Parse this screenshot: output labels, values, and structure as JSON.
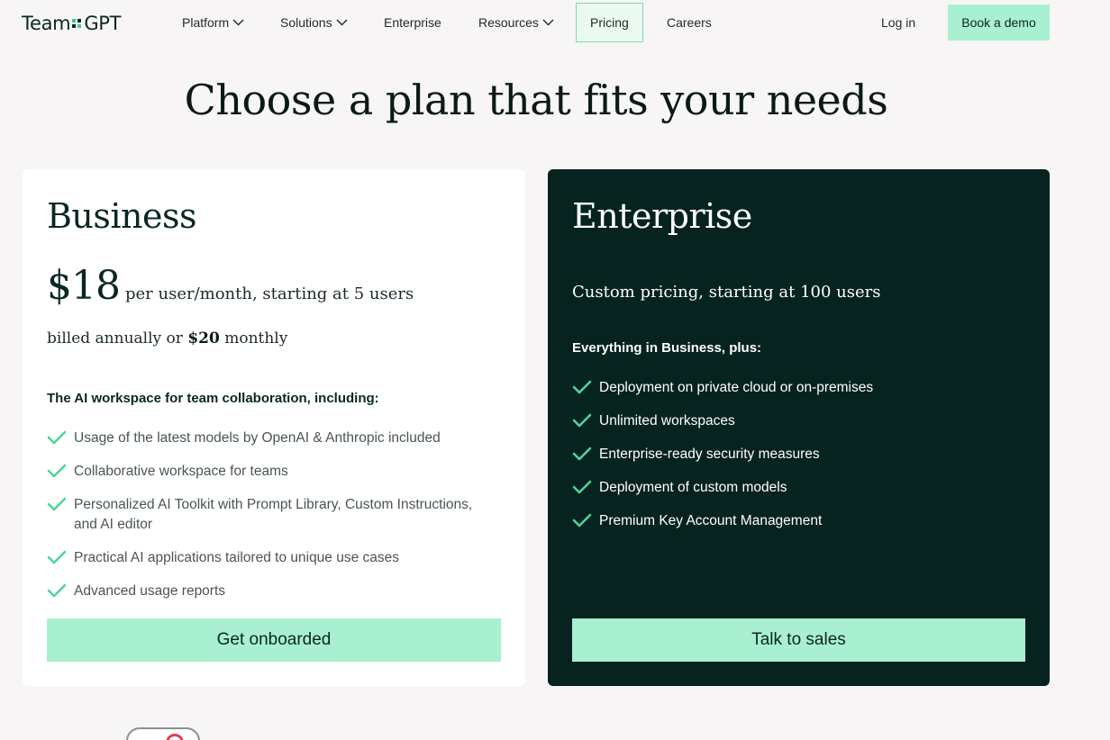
{
  "nav": {
    "logo_left": "Team",
    "logo_right": "GPT",
    "items": [
      {
        "label": "Platform"
      },
      {
        "label": "Solutions"
      },
      {
        "label": "Enterprise"
      },
      {
        "label": "Resources"
      },
      {
        "label": "Pricing"
      },
      {
        "label": "Careers"
      }
    ],
    "login": "Log in",
    "demo": "Book a demo"
  },
  "heading": "Choose a plan that fits your needs",
  "business": {
    "name": "Business",
    "price": "$18",
    "price_sub": "per user/month, starting at 5 users",
    "billed_a": "billed annually or ",
    "billed_b": "$20",
    "billed_c": " monthly",
    "features_head": "The AI workspace for team collaboration, including:",
    "features": [
      "Usage of the latest models by OpenAI & Anthropic included",
      "Collaborative workspace for teams",
      "Personalized AI Toolkit with Prompt Library, Custom Instructions, and AI editor",
      "Practical AI applications tailored to unique use cases",
      "Advanced usage reports"
    ],
    "cta": "Get onboarded"
  },
  "enterprise": {
    "name": "Enterprise",
    "custom": "Custom pricing, starting at 100 users",
    "features_head": "Everything in Business, plus:",
    "features": [
      "Deployment on private cloud or on-premises",
      "Unlimited workspaces",
      "Enterprise-ready security measures",
      "Deployment of custom models",
      "Premium Key Account Management"
    ],
    "cta": "Talk to sales"
  },
  "colors": {
    "accent": "#a8f0d1",
    "check": "#4fd49a",
    "dark": "#06231f",
    "background": "#f7f5f5"
  }
}
